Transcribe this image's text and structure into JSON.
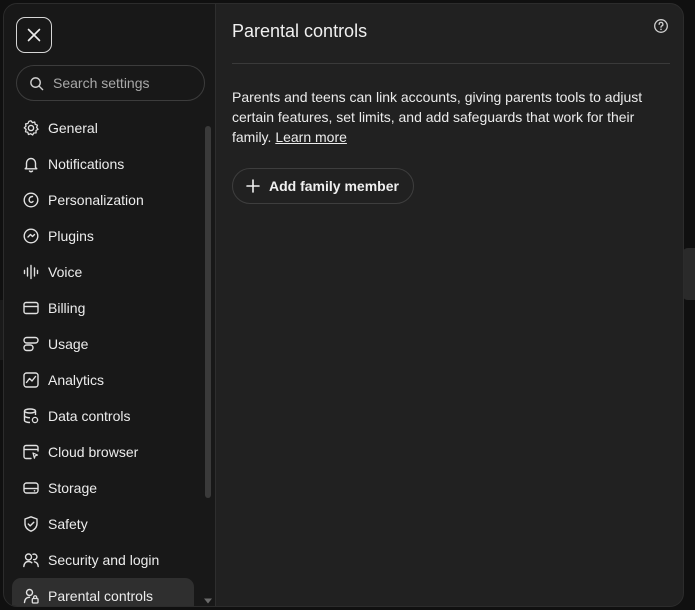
{
  "sidebar": {
    "close_icon": "close-icon",
    "search": {
      "placeholder": "Search settings",
      "value": ""
    },
    "items": [
      {
        "label": "General",
        "icon": "gear-icon"
      },
      {
        "label": "Notifications",
        "icon": "bell-icon"
      },
      {
        "label": "Personalization",
        "icon": "personalization-icon"
      },
      {
        "label": "Plugins",
        "icon": "plugin-icon"
      },
      {
        "label": "Voice",
        "icon": "waveform-icon"
      },
      {
        "label": "Billing",
        "icon": "credit-card-icon"
      },
      {
        "label": "Usage",
        "icon": "usage-icon"
      },
      {
        "label": "Analytics",
        "icon": "analytics-chart-icon"
      },
      {
        "label": "Data controls",
        "icon": "database-icon"
      },
      {
        "label": "Cloud browser",
        "icon": "browser-window-icon"
      },
      {
        "label": "Storage",
        "icon": "storage-drive-icon"
      },
      {
        "label": "Safety",
        "icon": "shield-check-icon"
      },
      {
        "label": "Security and login",
        "icon": "users-lock-icon"
      },
      {
        "label": "Parental controls",
        "icon": "user-lock-icon",
        "active": true
      }
    ]
  },
  "main": {
    "title": "Parental controls",
    "help_icon": "question-circle-icon",
    "description": "Parents and teens can link accounts, giving parents tools to adjust certain features, set limits, and add safeguards that work for their family.",
    "learn_more": "Learn more",
    "add_button_label": "Add family member",
    "add_button_icon": "plus-icon"
  },
  "colors": {
    "dialog_bg": "#212121",
    "sidebar_bg": "#181818",
    "active_item_bg": "#2f2f2f",
    "text": "#ececec"
  }
}
